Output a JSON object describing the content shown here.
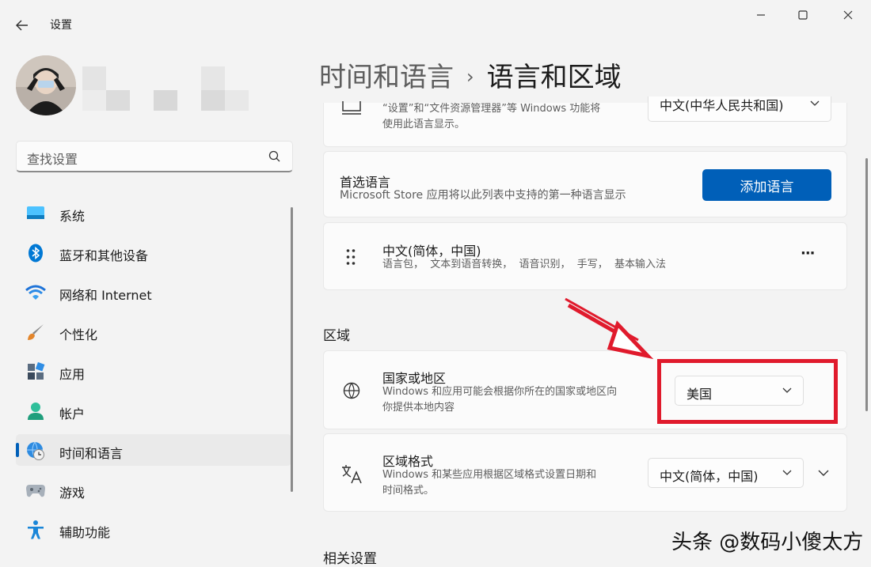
{
  "window": {
    "app_title": "设置"
  },
  "search": {
    "placeholder": "查找设置"
  },
  "sidebar": {
    "items": [
      {
        "label": "系统",
        "icon": "display-icon"
      },
      {
        "label": "蓝牙和其他设备",
        "icon": "bluetooth-icon"
      },
      {
        "label": "网络和 Internet",
        "icon": "wifi-icon"
      },
      {
        "label": "个性化",
        "icon": "brush-icon"
      },
      {
        "label": "应用",
        "icon": "apps-icon"
      },
      {
        "label": "帐户",
        "icon": "person-icon"
      },
      {
        "label": "时间和语言",
        "icon": "globe-clock-icon",
        "selected": true
      },
      {
        "label": "游戏",
        "icon": "gamepad-icon"
      },
      {
        "label": "辅助功能",
        "icon": "accessibility-icon"
      }
    ]
  },
  "breadcrumb": {
    "parent": "时间和语言",
    "separator": "›",
    "current": "语言和区域"
  },
  "display_language": {
    "desc_line1": "“设置”和“文件资源管理器”等 Windows 功能将",
    "desc_line2": "使用此语言显示。",
    "value": "中文(中华人民共和国)"
  },
  "preferred_language": {
    "title": "首选语言",
    "desc": "Microsoft Store 应用将以此列表中支持的第一种语言显示",
    "button": "添加语言"
  },
  "language_item": {
    "title": "中文(简体，中国)",
    "desc": "语言包，  文本到语音转换，  语音识别，  手写，  基本输入法",
    "more": "···"
  },
  "region": {
    "section_title": "区域",
    "country": {
      "title": "国家或地区",
      "desc_line1": "Windows 和应用可能会根据你所在的国家或地区向",
      "desc_line2": "你提供本地内容",
      "value": "美国"
    },
    "format": {
      "title": "区域格式",
      "desc_line1": "Windows 和某些应用根据区域格式设置日期和",
      "desc_line2": "时间格式。",
      "value": "中文(简体，中国)"
    }
  },
  "related": {
    "section_title": "相关设置"
  },
  "watermark": "头条 @数码小傻太方",
  "colors": {
    "accent": "#005fb8",
    "highlight": "#e01a2c"
  }
}
